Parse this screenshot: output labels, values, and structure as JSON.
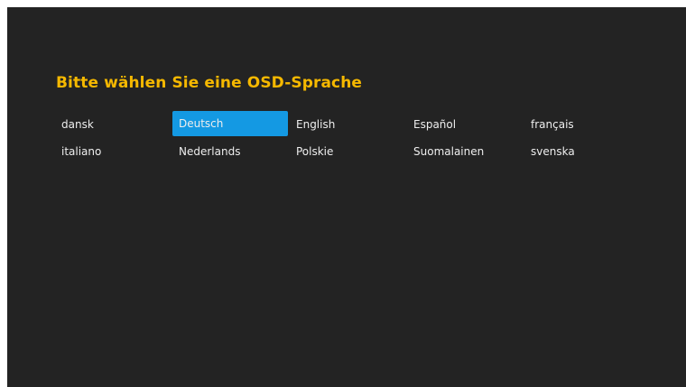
{
  "title": "Bitte wählen Sie eine OSD-Sprache",
  "selected_color": "#1499e3",
  "title_color": "#f5b800",
  "languages": [
    {
      "label": "dansk",
      "selected": false
    },
    {
      "label": "Deutsch",
      "selected": true
    },
    {
      "label": "English",
      "selected": false
    },
    {
      "label": "Español",
      "selected": false
    },
    {
      "label": "français",
      "selected": false
    },
    {
      "label": "italiano",
      "selected": false
    },
    {
      "label": "Nederlands",
      "selected": false
    },
    {
      "label": "Polskie",
      "selected": false
    },
    {
      "label": "Suomalainen",
      "selected": false
    },
    {
      "label": "svenska",
      "selected": false
    }
  ]
}
